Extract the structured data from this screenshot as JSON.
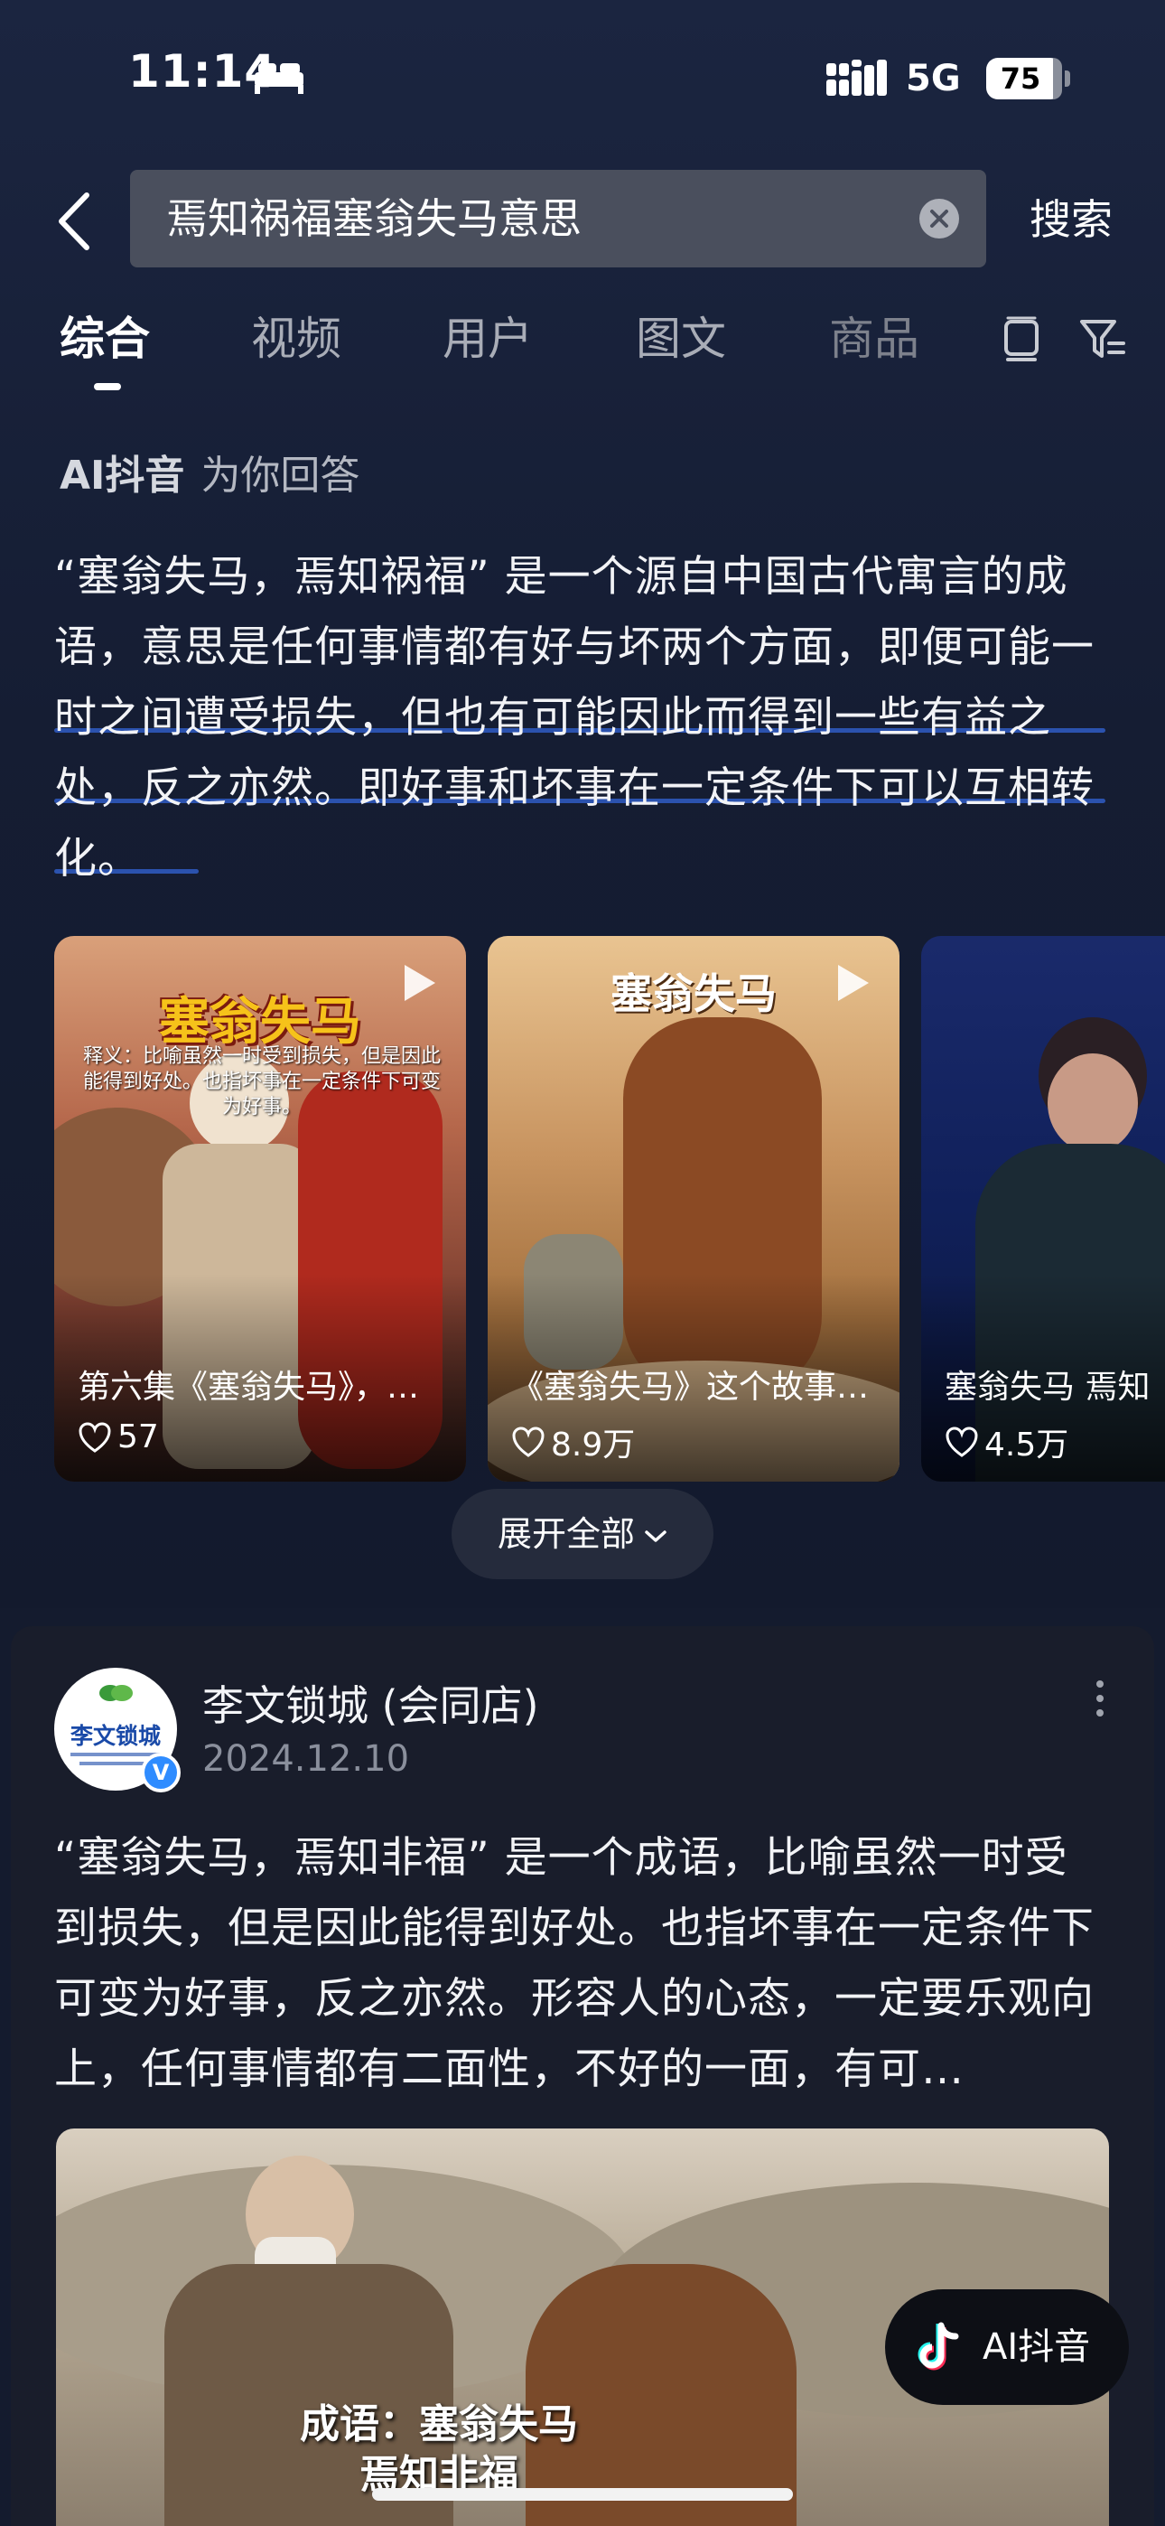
{
  "status_bar": {
    "time": "11:14",
    "network": "5G",
    "battery": "75"
  },
  "search": {
    "query": "焉知祸福塞翁失马意思",
    "button_label": "搜索"
  },
  "tabs": [
    "综合",
    "视频",
    "用户",
    "图文",
    "商品"
  ],
  "ai_answer": {
    "brand": "AI抖音",
    "subtitle": "为你回答",
    "text": "“塞翁失马，焉知祸福” 是一个源自中国古代寓言的成语，意思是任何事情都有好与坏两个方面，即便可能一时之间遭受损失，但也有可能因此而得到一些有益之处，反之亦然。即好事和坏事在一定条件下可以互相转化。"
  },
  "videos": [
    {
      "overlay_title": "塞翁失马",
      "overlay_caption": "释义：比喻虽然一时受到损失，但是因此能得到好处。也指坏事在一定条件下可变为好事。",
      "title": "第六集《塞翁失马》，…",
      "likes": "57"
    },
    {
      "overlay_title": "塞翁失马",
      "title": "《塞翁失马》这个故事…",
      "likes": "8.9万"
    },
    {
      "title": "塞翁失马 焉知",
      "likes": "4.5万"
    }
  ],
  "expand_label": "展开全部",
  "post": {
    "avatar_text": "李文锁城",
    "author": "李文锁城 (会同店)",
    "date": "2024.12.10",
    "text": "“塞翁失马，焉知非福” 是一个成语，比喻虽然一时受到损失，但是因此能得到好处。也指坏事在一定条件下可变为好事，反之亦然。形容人的心态，一定要乐观向上，任何事情都有二面性，不好的一面，有可…",
    "image_caption_line1": "成语：塞翁失马",
    "image_caption_line2": "焉知非福"
  },
  "ai_float_label": "AI抖音",
  "colors": {
    "background": "#141b2e",
    "highlight": "#2f5cc4",
    "verified": "#2f8cff"
  },
  "icons": [
    "bed-icon",
    "signal-icon",
    "battery-icon",
    "back-icon",
    "clear-icon",
    "layout-icon",
    "filter-icon",
    "play-icon",
    "heart-icon",
    "chevron-down-icon",
    "more-icon",
    "verified-icon",
    "tiktok-icon"
  ]
}
